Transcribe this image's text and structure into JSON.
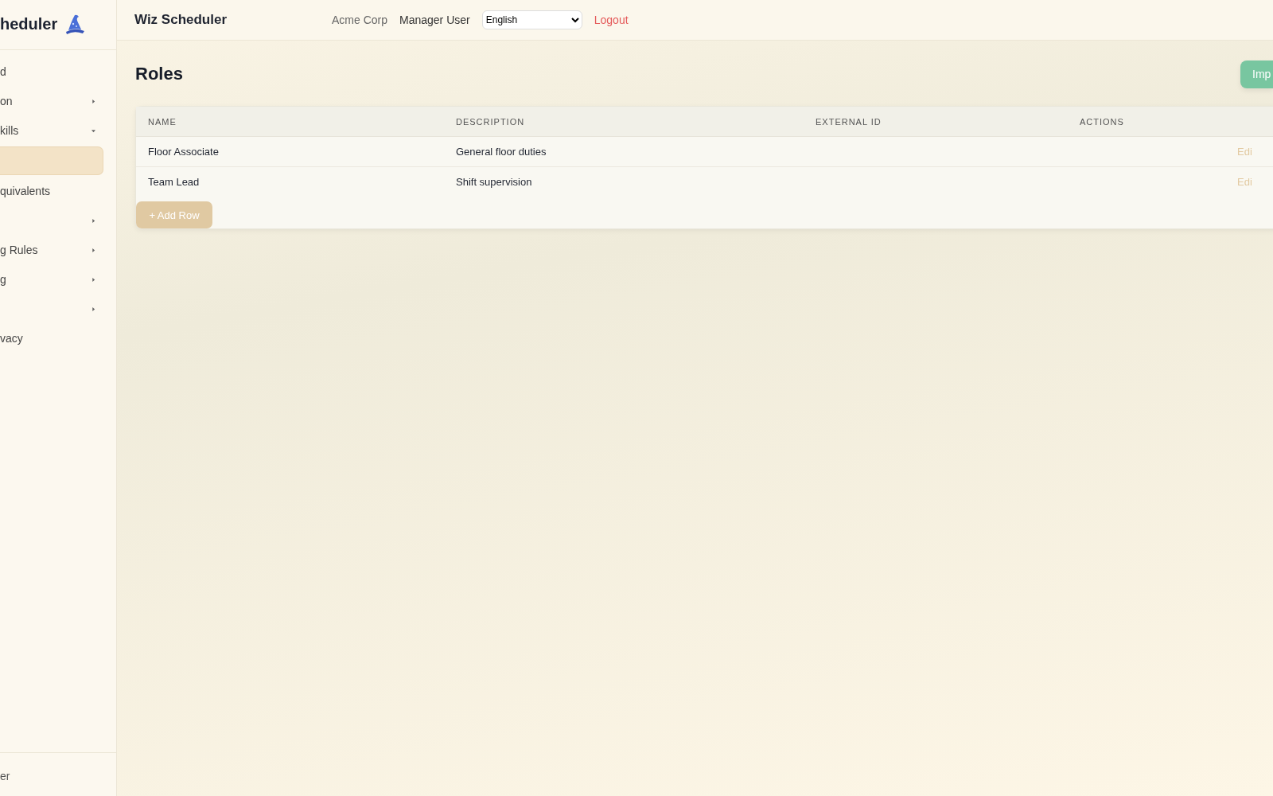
{
  "sidebar": {
    "brand": "heduler",
    "items": [
      {
        "label": "d",
        "kind": "link",
        "selected": false
      },
      {
        "label": "on",
        "kind": "group",
        "expanded": false,
        "selected": false
      },
      {
        "label": "kills",
        "kind": "group",
        "expanded": true,
        "selected": false
      },
      {
        "kind": "link",
        "selected": true
      },
      {
        "label": "quivalents",
        "kind": "link",
        "selected": false
      },
      {
        "kind": "group",
        "expanded": false,
        "selected": false
      },
      {
        "label": "g Rules",
        "kind": "group",
        "expanded": false,
        "selected": false
      },
      {
        "label": "g",
        "kind": "group",
        "expanded": false,
        "selected": false
      },
      {
        "kind": "group",
        "expanded": false,
        "selected": false
      },
      {
        "label": "vacy",
        "kind": "link",
        "selected": false
      }
    ],
    "footer": "er"
  },
  "topbar": {
    "title": "Wiz Scheduler",
    "company": "Acme Corp",
    "user": "Manager User",
    "language": "English",
    "logout": "Logout"
  },
  "page": {
    "title": "Roles",
    "import_button": "Imp"
  },
  "table": {
    "columns": [
      "NAME",
      "DESCRIPTION",
      "EXTERNAL ID",
      "ACTIONS"
    ],
    "rows": [
      {
        "name": "Floor Associate",
        "description": "General floor duties",
        "action": "Edi"
      },
      {
        "name": "Team Lead",
        "description": "Shift supervision",
        "action": "Edi"
      }
    ],
    "add_button": "+ Add Row"
  }
}
